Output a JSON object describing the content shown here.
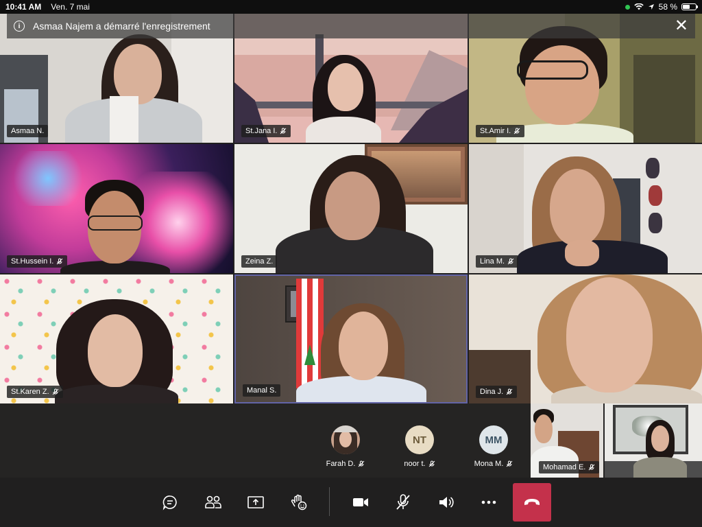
{
  "status_bar": {
    "time": "10:41 AM",
    "date": "Ven. 7 mai",
    "battery": "58 %",
    "battery_level": 0.58,
    "wifi_icon": "wifi-icon",
    "camera_indicator_color": "#31c553"
  },
  "banner": {
    "text": "Asmaa Najem a démarré l'enregistrement",
    "icon": "info-icon",
    "close_icon": "close-icon"
  },
  "participants_grid": [
    {
      "name": "Asmaa N.",
      "muted": false
    },
    {
      "name": "St.Jana I.",
      "muted": true
    },
    {
      "name": "St.Amir I.",
      "muted": true
    },
    {
      "name": "St.Hussein I.",
      "muted": true
    },
    {
      "name": "Zeina Z.",
      "muted": false
    },
    {
      "name": "Lina M.",
      "muted": true
    },
    {
      "name": "St.Karen Z.",
      "muted": true
    },
    {
      "name": "Manal S.",
      "muted": false,
      "active_speaker": true
    },
    {
      "name": "Dina J.",
      "muted": true
    }
  ],
  "participants_strip": [
    {
      "name": "Farah D.",
      "initials": "",
      "muted": true,
      "has_photo": true
    },
    {
      "name": "noor t.",
      "initials": "NT",
      "muted": true,
      "avatar_color": "#e8dcc4"
    },
    {
      "name": "Mona M.",
      "initials": "MM",
      "muted": true,
      "avatar_color": "#dfe6ea"
    },
    {
      "name": "Mohamad E.",
      "muted": true,
      "video": true
    },
    {
      "name": "",
      "muted": false,
      "video": true
    }
  ],
  "controls": {
    "items": [
      "chat-icon",
      "participants-icon",
      "share-screen-icon",
      "raise-hand-icon",
      "camera-icon",
      "mic-off-icon",
      "speaker-icon",
      "more-icon",
      "hang-up-icon"
    ],
    "hangup_color": "#c4314b"
  },
  "colors": {
    "background": "#201f1f",
    "active_speaker_border": "#6264a7"
  }
}
